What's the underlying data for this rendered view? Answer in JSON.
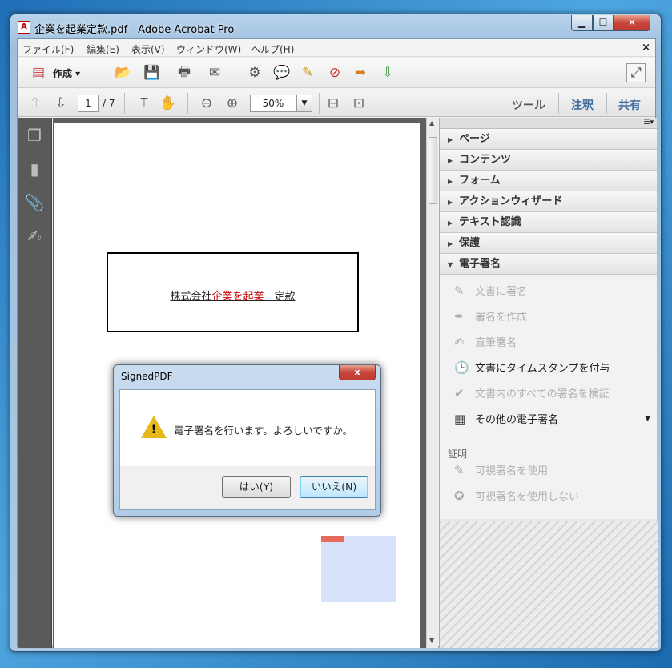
{
  "window": {
    "title": "企業を起業定款.pdf - Adobe Acrobat Pro",
    "app_icon": "pdf-icon"
  },
  "menu": [
    "ファイル(F)",
    "編集(E)",
    "表示(V)",
    "ウィンドウ(W)",
    "ヘルプ(H)"
  ],
  "menu_close": "×",
  "toolbar": {
    "create_label": "作成 ▾"
  },
  "nav": {
    "page": "1",
    "page_total": "/ 7",
    "zoom": "50%"
  },
  "right_tabs": [
    "ツール",
    "注釈",
    "共有"
  ],
  "document": {
    "heading_prefix": "株式会社",
    "heading_red": "企業を起業",
    "heading_suffix": "　定款"
  },
  "panel": {
    "sections": [
      "ページ",
      "コンテンツ",
      "フォーム",
      "アクションウィザード",
      "テキスト認識",
      "保護",
      "電子署名"
    ],
    "tools": [
      {
        "label": "文書に署名",
        "enabled": false
      },
      {
        "label": "署名を作成",
        "enabled": false
      },
      {
        "label": "直筆署名",
        "enabled": false
      },
      {
        "label": "文書にタイムスタンプを付与",
        "enabled": true
      },
      {
        "label": "文書内のすべての署名を検証",
        "enabled": false
      },
      {
        "label": "その他の電子署名",
        "enabled": true
      }
    ],
    "subheading": "証明",
    "cert_tools": [
      "可視署名を使用",
      "可視署名を使用しない"
    ]
  },
  "dialog": {
    "title": "SignedPDF",
    "message": "電子署名を行います。よろしいですか。",
    "yes": "はい(Y)",
    "no": "いいえ(N)",
    "close": "x"
  }
}
